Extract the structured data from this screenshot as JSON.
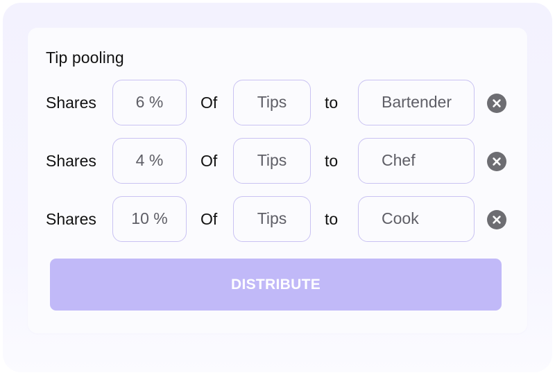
{
  "card": {
    "title": "Tip pooling"
  },
  "rows": [
    {
      "shares_label": "Shares",
      "percent": "6 %",
      "of_label": "Of",
      "source": "Tips",
      "to_label": "to",
      "role": "Bartender"
    },
    {
      "shares_label": "Shares",
      "percent": "4 %",
      "of_label": "Of",
      "source": "Tips",
      "to_label": "to",
      "role": "Chef"
    },
    {
      "shares_label": "Shares",
      "percent": "10 %",
      "of_label": "Of",
      "source": "Tips",
      "to_label": "to",
      "role": "Cook"
    }
  ],
  "icons": {
    "remove": "close-circle-icon"
  },
  "actions": {
    "distribute_label": "DISTRIBUTE"
  },
  "colors": {
    "accent": "#c1b9f8",
    "field_border": "#c9c2f2",
    "remove_icon": "#6d6d72",
    "backdrop": "#f3f2fe"
  }
}
